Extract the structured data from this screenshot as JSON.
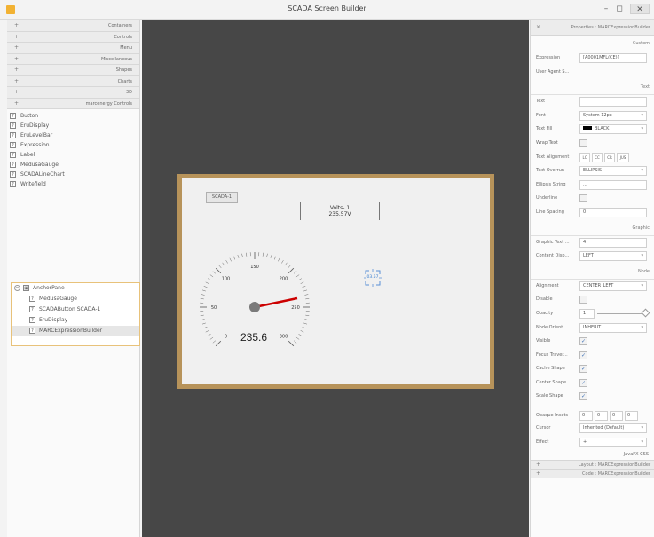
{
  "window": {
    "title": "SCADA Screen Builder",
    "minimize": "–",
    "maximize": "◻",
    "close": "✕"
  },
  "categories": [
    {
      "label": "Containers"
    },
    {
      "label": "Controls"
    },
    {
      "label": "Menu"
    },
    {
      "label": "Miscellaneous"
    },
    {
      "label": "Shapes"
    },
    {
      "label": "Charts"
    },
    {
      "label": "3D"
    },
    {
      "label": "marcenergy Controls"
    }
  ],
  "palette": [
    "Button",
    "EruDisplay",
    "EruLevelBar",
    "Expression",
    "Label",
    "MedusaGauge",
    "SCADALineChart",
    "Writefield"
  ],
  "hierarchy": {
    "root": "AnchorPane",
    "children": [
      {
        "label": "MedusaGauge"
      },
      {
        "label": "SCADAButton  SCADA-1"
      },
      {
        "label": "EruDisplay"
      },
      {
        "label": "MARCExpressionBuilder"
      }
    ]
  },
  "canvas": {
    "button_label": "SCADA-1",
    "chart_title": "Volts- 1",
    "chart_value": "235.57V",
    "gauge_value": "235.6",
    "gauge_ticks": [
      "0",
      "50",
      "100",
      "150",
      "200",
      "250",
      "300"
    ],
    "expression_value": "03.57"
  },
  "properties": {
    "header": "Properties : MARCExpressionBuilder",
    "sections": {
      "custom": "Custom",
      "text": "Text",
      "graphic": "Graphic",
      "node": "Node",
      "javafx": "JavaFX CSS"
    },
    "custom": {
      "expression_label": "Expression",
      "expression_value": "[A0001MFL(CE)]",
      "user_agent_label": "User Agent S..."
    },
    "text": {
      "text_label": "Text",
      "text_value": "",
      "font_label": "Font",
      "font_value": "System 12px",
      "fill_label": "Text Fill",
      "fill_value": "BLACK",
      "wrap_label": "Wrap Text",
      "align_label": "Text Alignment",
      "align_buttons": [
        "LC",
        "CC",
        "CR",
        "JUS"
      ],
      "overrun_label": "Text Overrun",
      "overrun_value": "ELLIPSIS",
      "ellipsis_label": "Ellipsis String",
      "ellipsis_value": "...",
      "underline_label": "Underline",
      "spacing_label": "Line Spacing",
      "spacing_value": "0"
    },
    "graphic": {
      "gap_label": "Graphic Text ...",
      "gap_value": "4",
      "display_label": "Content Disp...",
      "display_value": "LEFT"
    },
    "node": {
      "alignment_label": "Alignment",
      "alignment_value": "CENTER_LEFT",
      "disable_label": "Disable",
      "opacity_label": "Opacity",
      "opacity_value": "1",
      "orient_label": "Node Orient...",
      "orient_value": "INHERIT",
      "visible_label": "Visible",
      "focus_label": "Focus Traver...",
      "cache_label": "Cache Shape",
      "center_label": "Center Shape",
      "scale_label": "Scale Shape",
      "insets_label": "Opaque Insets",
      "insets": [
        "0",
        "0",
        "0",
        "0"
      ],
      "cursor_label": "Cursor",
      "cursor_value": "Inherited (Default)",
      "effect_label": "Effect",
      "effect_value": "+"
    },
    "footer": {
      "layout": "Layout : MARCExpressionBuilder",
      "code": "Code : MARCExpressionBuilder"
    }
  },
  "colors": {
    "accent": "#b7935a",
    "canvas_bg": "#474747",
    "needle": "#cc0000",
    "check": "#3a6eb5"
  }
}
